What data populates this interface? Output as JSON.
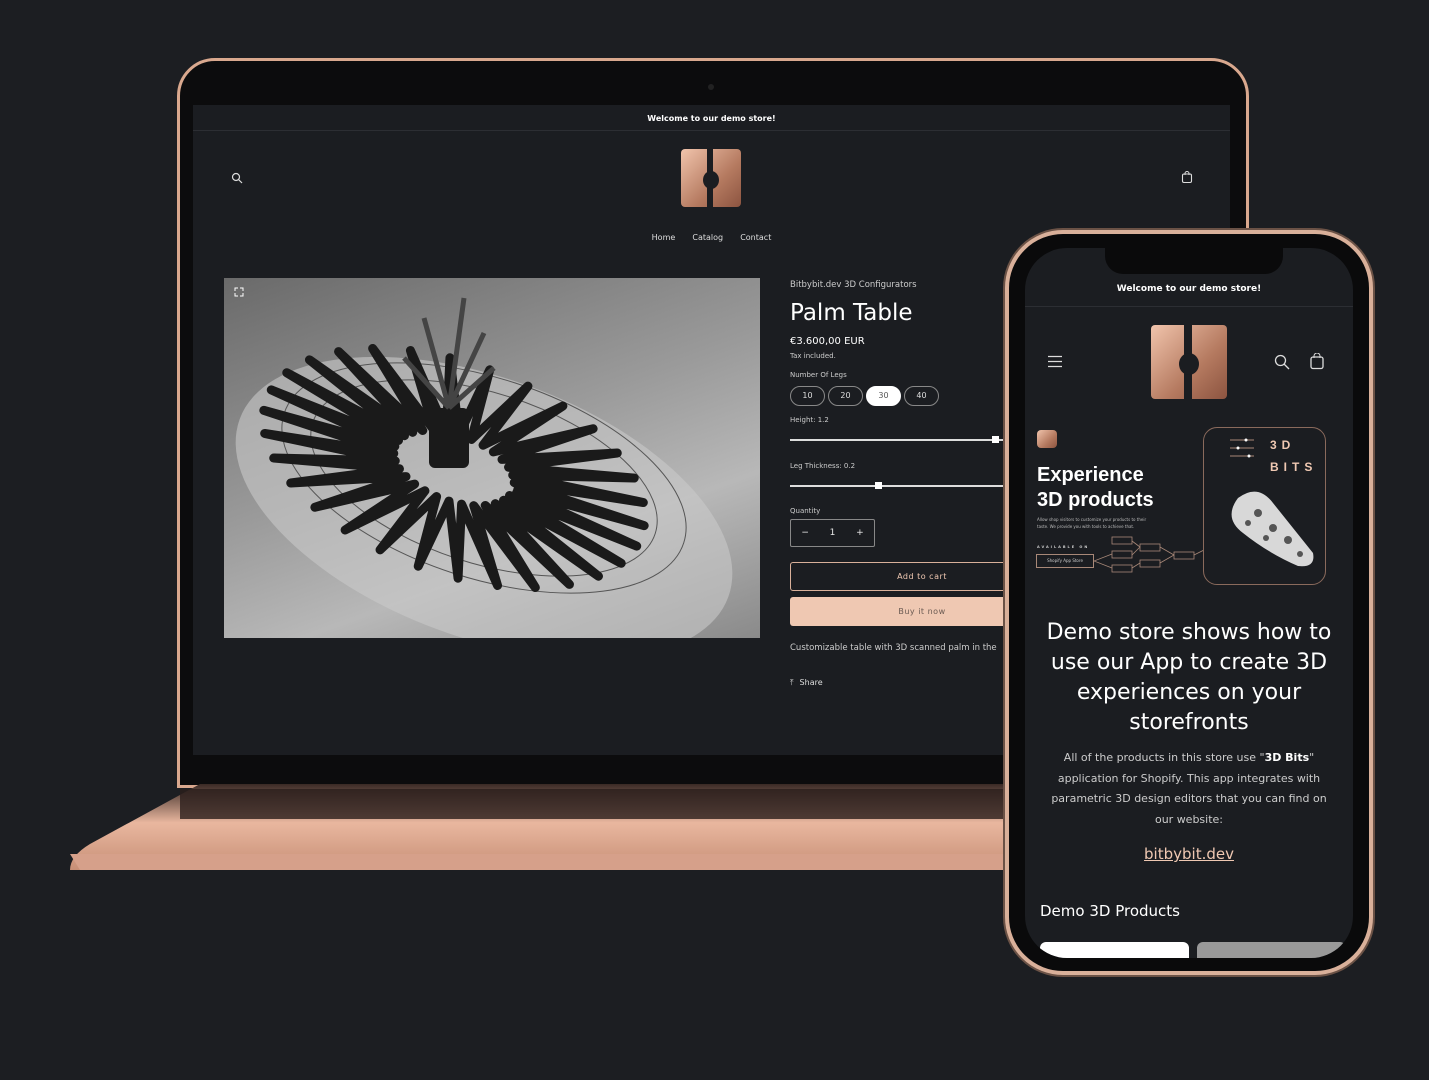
{
  "store": {
    "announcement": "Welcome to our demo store!",
    "nav": [
      "Home",
      "Catalog",
      "Contact"
    ],
    "icons": {
      "search": "search-icon",
      "cart": "cart-icon",
      "menu": "hamburger-icon",
      "expand": "expand-icon",
      "share": "share-icon"
    },
    "accent": "#efc8b2"
  },
  "product": {
    "vendor": "Bitbybit.dev 3D Configurators",
    "title": "Palm Table",
    "price": "€3.600,00 EUR",
    "tax_note": "Tax included.",
    "legs_label": "Number Of Legs",
    "legs_options": [
      "10",
      "20",
      "30",
      "40"
    ],
    "legs_selected": "30",
    "height_label": "Height: 1.2",
    "height_value": 1.2,
    "thickness_label": "Leg Thickness: 0.2",
    "thickness_value": 0.2,
    "quantity_label": "Quantity",
    "quantity": "1",
    "minus": "−",
    "plus": "+",
    "add_to_cart": "Add to cart",
    "buy_now": "Buy it now",
    "description": "Customizable table with 3D scanned palm in the",
    "share": "Share"
  },
  "mobile": {
    "banner": {
      "title_line1": "Experience",
      "title_line2": "3D products",
      "body": "Allow shop visitors to customize your products to their taste. We provide you with tools to achieve that.",
      "available_on": "AVAILABLE ON",
      "store_button": "Shopify App Store",
      "brand_line1": "3D",
      "brand_line2": "BITS"
    },
    "headline": "Demo store shows how to use our App to create 3D experiences on your storefronts",
    "body_pre": "All of the products in this store use \"",
    "body_bold": "3D Bits",
    "body_post": "\" application for Shopify. This app integrates with parametric 3D design editors that you can find on our website:",
    "link": "bitbybit.dev",
    "section_title": "Demo 3D Products"
  }
}
